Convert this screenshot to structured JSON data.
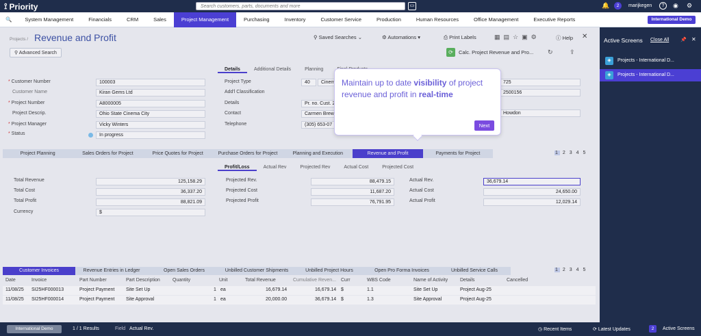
{
  "app": {
    "name": "Priority",
    "search_placeholder": "Search customers, parts, documents and more",
    "user": "marijkegen",
    "notif_count": "2",
    "company_badge": "International Demo"
  },
  "menu": [
    "System Management",
    "Financials",
    "CRM",
    "Sales",
    "Project Management",
    "Purchasing",
    "Inventory",
    "Customer Service",
    "Production",
    "Human Resources",
    "Office Management",
    "Executive Reports"
  ],
  "page": {
    "breadcrumb": "Projects /",
    "title": "Revenue and Profit",
    "advanced_search": "Advanced Search",
    "saved_searches": "Saved Searches",
    "automations": "Automations",
    "print_labels": "Print Labels",
    "help": "Help",
    "calc_action": "Calc. Project Revenue and Pro..."
  },
  "header_tabs": [
    "Details",
    "Additional Details",
    "Planning",
    "Final Products"
  ],
  "left_fields": [
    {
      "label": "Customer Number",
      "value": "100003",
      "req": true
    },
    {
      "label": "Customer Name",
      "value": "Kiran Gems Ltd",
      "req": false
    },
    {
      "label": "Project Number",
      "value": "A8000005",
      "req": true
    },
    {
      "label": "Project Descrip.",
      "value": "Ohio State Cinema City",
      "req": false
    },
    {
      "label": "Project Manager",
      "value": "Vicky Winters",
      "req": true
    },
    {
      "label": "Status",
      "value": "In progress",
      "req": true
    }
  ],
  "right_fields": [
    {
      "label": "Project Type",
      "value": "40",
      "extra": "Cinem"
    },
    {
      "label": "Add'l Classification",
      "value": ""
    },
    {
      "label": "Details",
      "value": "Pr. no. Cust. 2"
    },
    {
      "label": "Contact",
      "value": "Carmen Brew"
    },
    {
      "label": "Telephone",
      "value": "(305) 653-07"
    }
  ],
  "right_extra": {
    "date": "725",
    "number": "2500156",
    "name": "Howdon"
  },
  "popover": {
    "text_parts": [
      "Maintain up to date ",
      "visibility",
      " of project revenue and profit in ",
      "real-time"
    ],
    "next_label": "Next"
  },
  "mid_tabs": [
    "Project Planning",
    "Sales Orders for Project",
    "Price Quotes for Project",
    "Purchase Orders for Project",
    "Planning and Execution",
    "Revenue and Profit",
    "Payments for Project"
  ],
  "pages": [
    "1",
    "2",
    "3",
    "4",
    "5"
  ],
  "sub_tabs": [
    "Profit/Loss",
    "Actual Rev",
    "Projected Rev",
    "Actual Cost",
    "Projected Cost"
  ],
  "totals": [
    {
      "label": "Total Revenue",
      "value": "125,158.29"
    },
    {
      "label": "Total Cost",
      "value": "36,337.20"
    },
    {
      "label": "Total Profit",
      "value": "88,821.09"
    },
    {
      "label": "Currency",
      "value": "$"
    }
  ],
  "projected": [
    {
      "label": "Projected Rev.",
      "value": "88,479.15"
    },
    {
      "label": "Projected Cost",
      "value": "11,687.20"
    },
    {
      "label": "Projected Profit",
      "value": "76,791.95"
    }
  ],
  "actual": [
    {
      "label": "Actual Rev.",
      "value": "36,679.14"
    },
    {
      "label": "Actual Cost",
      "value": "24,650.00"
    },
    {
      "label": "Actual Profit",
      "value": "12,029.14"
    }
  ],
  "bottom_tabs": [
    "Customer Invoices",
    "Revenue Entries in Ledger",
    "Open Sales Orders",
    "Unbilled Customer Shipments",
    "Unbilled Project Hours",
    "Open Pro Forma Invoices",
    "Unbilled Service Calls"
  ],
  "grid_headers": [
    "Date",
    "Invoice",
    "Part Number",
    "Part Description",
    "Quantity",
    "Unit",
    "Total Revenue",
    "Cumulative Reven...",
    "Curr",
    "WBS Code",
    "Name of Activity",
    "Details",
    "Cancelled"
  ],
  "grid_rows": [
    [
      "11/08/25",
      "SI25HF000013",
      "Project Payment",
      "Site Set Up",
      "1",
      "ea",
      "16,679.14",
      "16,679.14",
      "$",
      "1.1",
      "Site Set Up",
      "Project Aug-25",
      ""
    ],
    [
      "11/08/25",
      "SI25HF000014",
      "Project Payment",
      "Site Approval",
      "1",
      "ea",
      "20,000.00",
      "36,679.14",
      "$",
      "1.3",
      "Site Approval",
      "Project Aug-25",
      ""
    ]
  ],
  "right_panel": {
    "title": "Active Screens",
    "close_all": "Close All",
    "items": [
      "Projects - International D...",
      "Projects - International D..."
    ]
  },
  "status": {
    "company": "International Demo",
    "results": "1 / 1 Results",
    "field_label": "Field",
    "field_value": "Actual Rev.",
    "recent": "Recent Items",
    "updates": "Latest Updates",
    "active": "Active Screens",
    "active_count": "2"
  }
}
